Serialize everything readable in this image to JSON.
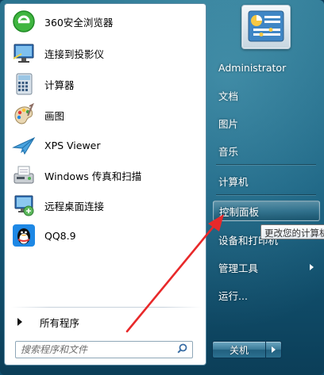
{
  "programs": [
    {
      "label": "360安全浏览器",
      "icon": "browser-360-icon"
    },
    {
      "label": "连接到投影仪",
      "icon": "projector-icon"
    },
    {
      "label": "计算器",
      "icon": "calculator-icon"
    },
    {
      "label": "画图",
      "icon": "paint-palette-icon"
    },
    {
      "label": "XPS Viewer",
      "icon": "xps-viewer-icon"
    },
    {
      "label": "Windows 传真和扫描",
      "icon": "fax-scan-icon"
    },
    {
      "label": "远程桌面连接",
      "icon": "remote-desktop-icon"
    },
    {
      "label": "QQ8.9",
      "icon": "qq-penguin-icon"
    }
  ],
  "all_programs": "所有程序",
  "search": {
    "placeholder": "搜索程序和文件"
  },
  "right_menu": {
    "user": "Administrator",
    "documents": "文档",
    "pictures": "图片",
    "music": "音乐",
    "computer": "计算机",
    "control_panel": "控制面板",
    "devices_printers": "设备和打印机",
    "admin_tools": "管理工具",
    "run": "运行..."
  },
  "tooltip": "更改您的计算机设置并自定义其功能。",
  "shutdown_label": "关机",
  "colors": {
    "accent_arrow": "#e8292a",
    "left_pane": "#ffffff",
    "glass": "#1d6c8c"
  }
}
